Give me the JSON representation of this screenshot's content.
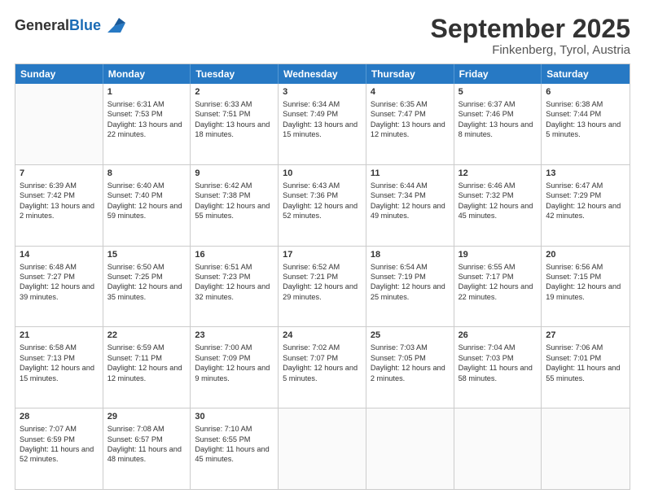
{
  "logo": {
    "line1": "General",
    "line2": "Blue"
  },
  "header": {
    "month": "September 2025",
    "location": "Finkenberg, Tyrol, Austria"
  },
  "weekdays": [
    "Sunday",
    "Monday",
    "Tuesday",
    "Wednesday",
    "Thursday",
    "Friday",
    "Saturday"
  ],
  "rows": [
    [
      {
        "day": "",
        "sunrise": "",
        "sunset": "",
        "daylight": ""
      },
      {
        "day": "1",
        "sunrise": "Sunrise: 6:31 AM",
        "sunset": "Sunset: 7:53 PM",
        "daylight": "Daylight: 13 hours and 22 minutes."
      },
      {
        "day": "2",
        "sunrise": "Sunrise: 6:33 AM",
        "sunset": "Sunset: 7:51 PM",
        "daylight": "Daylight: 13 hours and 18 minutes."
      },
      {
        "day": "3",
        "sunrise": "Sunrise: 6:34 AM",
        "sunset": "Sunset: 7:49 PM",
        "daylight": "Daylight: 13 hours and 15 minutes."
      },
      {
        "day": "4",
        "sunrise": "Sunrise: 6:35 AM",
        "sunset": "Sunset: 7:47 PM",
        "daylight": "Daylight: 13 hours and 12 minutes."
      },
      {
        "day": "5",
        "sunrise": "Sunrise: 6:37 AM",
        "sunset": "Sunset: 7:46 PM",
        "daylight": "Daylight: 13 hours and 8 minutes."
      },
      {
        "day": "6",
        "sunrise": "Sunrise: 6:38 AM",
        "sunset": "Sunset: 7:44 PM",
        "daylight": "Daylight: 13 hours and 5 minutes."
      }
    ],
    [
      {
        "day": "7",
        "sunrise": "Sunrise: 6:39 AM",
        "sunset": "Sunset: 7:42 PM",
        "daylight": "Daylight: 13 hours and 2 minutes."
      },
      {
        "day": "8",
        "sunrise": "Sunrise: 6:40 AM",
        "sunset": "Sunset: 7:40 PM",
        "daylight": "Daylight: 12 hours and 59 minutes."
      },
      {
        "day": "9",
        "sunrise": "Sunrise: 6:42 AM",
        "sunset": "Sunset: 7:38 PM",
        "daylight": "Daylight: 12 hours and 55 minutes."
      },
      {
        "day": "10",
        "sunrise": "Sunrise: 6:43 AM",
        "sunset": "Sunset: 7:36 PM",
        "daylight": "Daylight: 12 hours and 52 minutes."
      },
      {
        "day": "11",
        "sunrise": "Sunrise: 6:44 AM",
        "sunset": "Sunset: 7:34 PM",
        "daylight": "Daylight: 12 hours and 49 minutes."
      },
      {
        "day": "12",
        "sunrise": "Sunrise: 6:46 AM",
        "sunset": "Sunset: 7:32 PM",
        "daylight": "Daylight: 12 hours and 45 minutes."
      },
      {
        "day": "13",
        "sunrise": "Sunrise: 6:47 AM",
        "sunset": "Sunset: 7:29 PM",
        "daylight": "Daylight: 12 hours and 42 minutes."
      }
    ],
    [
      {
        "day": "14",
        "sunrise": "Sunrise: 6:48 AM",
        "sunset": "Sunset: 7:27 PM",
        "daylight": "Daylight: 12 hours and 39 minutes."
      },
      {
        "day": "15",
        "sunrise": "Sunrise: 6:50 AM",
        "sunset": "Sunset: 7:25 PM",
        "daylight": "Daylight: 12 hours and 35 minutes."
      },
      {
        "day": "16",
        "sunrise": "Sunrise: 6:51 AM",
        "sunset": "Sunset: 7:23 PM",
        "daylight": "Daylight: 12 hours and 32 minutes."
      },
      {
        "day": "17",
        "sunrise": "Sunrise: 6:52 AM",
        "sunset": "Sunset: 7:21 PM",
        "daylight": "Daylight: 12 hours and 29 minutes."
      },
      {
        "day": "18",
        "sunrise": "Sunrise: 6:54 AM",
        "sunset": "Sunset: 7:19 PM",
        "daylight": "Daylight: 12 hours and 25 minutes."
      },
      {
        "day": "19",
        "sunrise": "Sunrise: 6:55 AM",
        "sunset": "Sunset: 7:17 PM",
        "daylight": "Daylight: 12 hours and 22 minutes."
      },
      {
        "day": "20",
        "sunrise": "Sunrise: 6:56 AM",
        "sunset": "Sunset: 7:15 PM",
        "daylight": "Daylight: 12 hours and 19 minutes."
      }
    ],
    [
      {
        "day": "21",
        "sunrise": "Sunrise: 6:58 AM",
        "sunset": "Sunset: 7:13 PM",
        "daylight": "Daylight: 12 hours and 15 minutes."
      },
      {
        "day": "22",
        "sunrise": "Sunrise: 6:59 AM",
        "sunset": "Sunset: 7:11 PM",
        "daylight": "Daylight: 12 hours and 12 minutes."
      },
      {
        "day": "23",
        "sunrise": "Sunrise: 7:00 AM",
        "sunset": "Sunset: 7:09 PM",
        "daylight": "Daylight: 12 hours and 9 minutes."
      },
      {
        "day": "24",
        "sunrise": "Sunrise: 7:02 AM",
        "sunset": "Sunset: 7:07 PM",
        "daylight": "Daylight: 12 hours and 5 minutes."
      },
      {
        "day": "25",
        "sunrise": "Sunrise: 7:03 AM",
        "sunset": "Sunset: 7:05 PM",
        "daylight": "Daylight: 12 hours and 2 minutes."
      },
      {
        "day": "26",
        "sunrise": "Sunrise: 7:04 AM",
        "sunset": "Sunset: 7:03 PM",
        "daylight": "Daylight: 11 hours and 58 minutes."
      },
      {
        "day": "27",
        "sunrise": "Sunrise: 7:06 AM",
        "sunset": "Sunset: 7:01 PM",
        "daylight": "Daylight: 11 hours and 55 minutes."
      }
    ],
    [
      {
        "day": "28",
        "sunrise": "Sunrise: 7:07 AM",
        "sunset": "Sunset: 6:59 PM",
        "daylight": "Daylight: 11 hours and 52 minutes."
      },
      {
        "day": "29",
        "sunrise": "Sunrise: 7:08 AM",
        "sunset": "Sunset: 6:57 PM",
        "daylight": "Daylight: 11 hours and 48 minutes."
      },
      {
        "day": "30",
        "sunrise": "Sunrise: 7:10 AM",
        "sunset": "Sunset: 6:55 PM",
        "daylight": "Daylight: 11 hours and 45 minutes."
      },
      {
        "day": "",
        "sunrise": "",
        "sunset": "",
        "daylight": ""
      },
      {
        "day": "",
        "sunrise": "",
        "sunset": "",
        "daylight": ""
      },
      {
        "day": "",
        "sunrise": "",
        "sunset": "",
        "daylight": ""
      },
      {
        "day": "",
        "sunrise": "",
        "sunset": "",
        "daylight": ""
      }
    ]
  ]
}
